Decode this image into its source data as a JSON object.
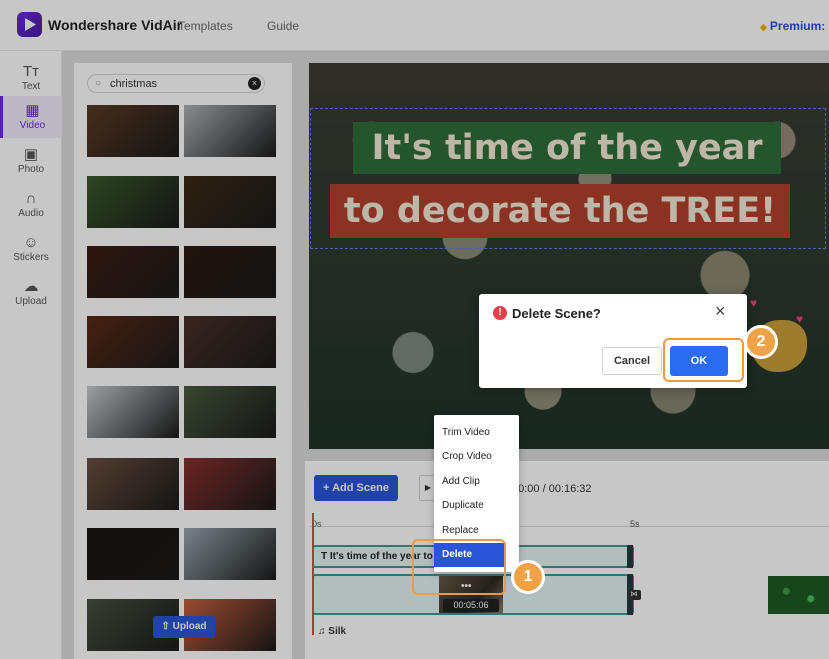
{
  "header": {
    "app_name": "Wondershare VidAir",
    "nav": [
      "Templates",
      "Guide"
    ],
    "premium_label": "Premium: S"
  },
  "sidebar": {
    "items": [
      {
        "label": "Text",
        "icon": "text-icon",
        "glyph": "Tт"
      },
      {
        "label": "Video",
        "icon": "video-icon",
        "glyph": "▦",
        "active": true
      },
      {
        "label": "Photo",
        "icon": "photo-icon",
        "glyph": "▣"
      },
      {
        "label": "Audio",
        "icon": "headphones-icon",
        "glyph": "∩"
      },
      {
        "label": "Stickers",
        "icon": "smiley-icon",
        "glyph": "☺"
      },
      {
        "label": "Upload",
        "icon": "upload-icon",
        "glyph": "☁"
      }
    ]
  },
  "media": {
    "search_value": "christmas",
    "upload_label": "Upload",
    "thumb_colors": [
      [
        "#5a3a24",
        "#b0b4b8"
      ],
      [
        "#3a5a2c",
        "#3a2a18"
      ],
      [
        "#3a1d12",
        "#2a1a10"
      ],
      [
        "#5a2a18",
        "#4a3028"
      ],
      [
        "#c8ccd0",
        "#4a5a40"
      ],
      [
        "#6a5040",
        "#8a3030"
      ],
      [
        "#1a1410",
        "#9aa8b0"
      ],
      [
        "#4a5040",
        "#c86040"
      ]
    ]
  },
  "preview": {
    "line1": "It's time of the year",
    "line2": "to decorate the TREE!",
    "line1_bg": "#2f6e3a",
    "line2_bg": "#b2402e"
  },
  "timeline": {
    "add_scene_label": "Add Scene",
    "play_icon": "play-icon",
    "timecode": "00:00 / 00:16:32",
    "ticks": [
      "0s",
      "5s"
    ],
    "text_track_label": "It's time of the year to d",
    "clip_time": "00:05:06",
    "audio_label": "Silk"
  },
  "context_menu": {
    "items": [
      "Trim Video",
      "Crop Video",
      "Add Clip",
      "Duplicate",
      "Replace",
      "Delete"
    ],
    "active_item": "Delete"
  },
  "dialog": {
    "title": "Delete Scene?",
    "cancel_label": "Cancel",
    "ok_label": "OK"
  },
  "callouts": [
    "1",
    "2"
  ],
  "colors": {
    "brand_purple": "#6a2bd9",
    "primary_blue": "#2b55d9",
    "ok_blue": "#2b6cf2",
    "highlight_orange": "#f09a3e",
    "warning_red": "#e5404a",
    "track_teal": "#3a9a98"
  }
}
